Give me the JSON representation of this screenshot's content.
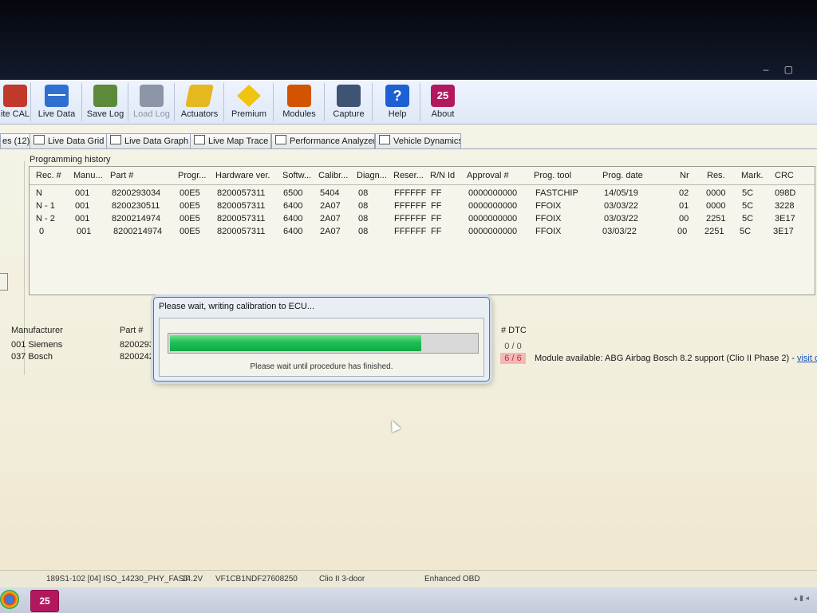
{
  "window": {
    "controls": "– ▢"
  },
  "toolbar": [
    {
      "label": "ite CAL",
      "icon": "write-cal-icon",
      "disabled": false
    },
    {
      "label": "Live Data",
      "icon": "live-data-icon",
      "disabled": false
    },
    {
      "label": "Save Log",
      "icon": "save-log-icon",
      "disabled": false
    },
    {
      "label": "Load Log",
      "icon": "load-log-icon",
      "disabled": true
    },
    {
      "label": "Actuators",
      "icon": "actuators-icon",
      "disabled": false
    },
    {
      "label": "Premium",
      "icon": "premium-icon",
      "disabled": false
    },
    {
      "label": "Modules",
      "icon": "modules-icon",
      "disabled": false
    },
    {
      "label": "Capture",
      "icon": "capture-icon",
      "disabled": false
    },
    {
      "label": "Help",
      "icon": "help-icon",
      "disabled": false
    },
    {
      "label": "About",
      "icon": "about-icon",
      "disabled": false
    }
  ],
  "tabs": [
    {
      "label": "es (12)"
    },
    {
      "label": "Live Data Grid"
    },
    {
      "label": "Live Data Graph"
    },
    {
      "label": "Live Map Trace"
    },
    {
      "label": "Performance Analyzer"
    },
    {
      "label": "Vehicle Dynamics"
    }
  ],
  "history": {
    "title": "Programming history",
    "columns": [
      "Rec. #",
      "Manu...",
      "Part #",
      "Progr...",
      "Hardware ver.",
      "Softw...",
      "Calibr...",
      "Diagn...",
      "Reser...",
      "R/N Id",
      "Approval #",
      "Prog. tool",
      "Prog. date",
      "Nr",
      "Res.",
      "Mark.",
      "CRC"
    ],
    "rows": [
      [
        "N",
        "001",
        "8200293034",
        "00E5",
        "8200057311",
        "6500",
        "5404",
        "08",
        "FFFFFF",
        "FF",
        "0000000000",
        "FASTCHIP",
        "14/05/19",
        "02",
        "0000",
        "5C",
        "098D"
      ],
      [
        "N - 1",
        "001",
        "8200230511",
        "00E5",
        "8200057311",
        "6400",
        "2A07",
        "08",
        "FFFFFF",
        "FF",
        "0000000000",
        "FFOIX",
        "03/03/22",
        "01",
        "0000",
        "5C",
        "3228"
      ],
      [
        "N - 2",
        "001",
        "8200214974",
        "00E5",
        "8200057311",
        "6400",
        "2A07",
        "08",
        "FFFFFF",
        "FF",
        "0000000000",
        "FFOIX",
        "03/03/22",
        "00",
        "2251",
        "5C",
        "3E17"
      ],
      [
        "0",
        "001",
        "8200214974",
        "00E5",
        "8200057311",
        "6400",
        "2A07",
        "08",
        "FFFFFF",
        "FF",
        "0000000000",
        "FFOIX",
        "03/03/22",
        "00",
        "2251",
        "5C",
        "3E17"
      ]
    ]
  },
  "modules": {
    "headers": {
      "manufacturer": "Manufacturer",
      "part": "Part #",
      "dtc": "# DTC"
    },
    "rows": [
      {
        "manufacturer": "001 Siemens",
        "part": "8200293",
        "dtc": "0 / 0",
        "dtc_bad": false,
        "info": ""
      },
      {
        "manufacturer": "037 Bosch",
        "part": "8200242",
        "dtc": "6 / 6",
        "dtc_bad": true,
        "info": "Module available: ABG Airbag Bosch 8.2 support (Clio II Phase 2) - ",
        "link": "visit our sh"
      }
    ]
  },
  "dialog": {
    "title": "Please wait, writing calibration to ECU...",
    "progress": 0.82,
    "message": "Please wait until procedure has finished."
  },
  "status": {
    "protocol": "189S1-102 [04] ISO_14230_PHY_FAST",
    "voltage": "14.2V",
    "vin": "VF1CB1NDF27608250",
    "vehicle": "Clio II 3-door",
    "mode": "Enhanced OBD"
  },
  "taskbar": {
    "app_label": "25"
  },
  "colors": {
    "progress_fill": "#1fbf55",
    "dtc_bad_bg": "#f3b7b7",
    "link": "#1a4fb8",
    "about_icon": "#b3185e"
  }
}
